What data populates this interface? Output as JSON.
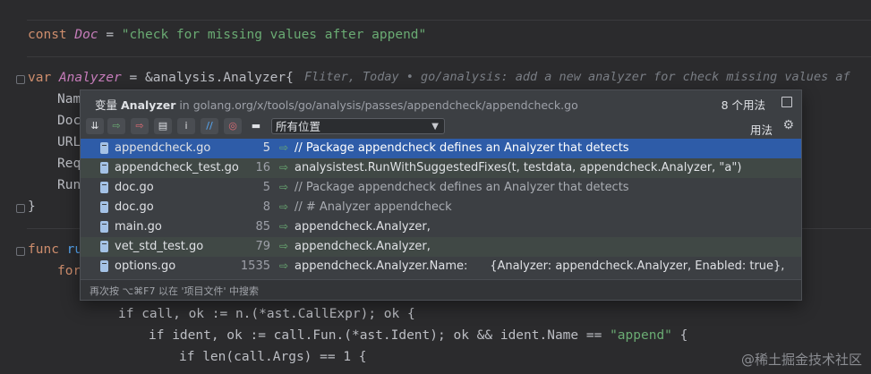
{
  "code": {
    "line_const_kw": "const",
    "line_const_name": "Doc",
    "line_const_eq": " = ",
    "line_const_str": "\"check for missing values after append\"",
    "line_var_kw": "var",
    "line_var_name": " Analyzer",
    "line_var_rest": " = &analysis.Analyzer{",
    "inline_hint": "Fliter, Today • go/analysis: add a new analyzer for check missing values af",
    "field_1": "Nam",
    "field_2": "Doc",
    "field_3": "URL",
    "field_4": "Req",
    "field_5": "Run",
    "close_brace": "}",
    "func_kw": "func",
    "func_rest": " ru",
    "for_kw": "for",
    "if_call_line": "if call, ok := n.(*ast.CallExpr); ok {",
    "if_ident_line_a": "if ident, ok := call.Fun.(*ast.Ident); ok && ident.Name == ",
    "if_ident_str": "\"append\"",
    "if_ident_tail": " {",
    "if_len_line": "if len(call.Args) == 1 {"
  },
  "popup": {
    "title_kind": "变量",
    "title_name": "Analyzer",
    "title_in": " in golang.org/x/tools/go/analysis/passes/appendcheck/appendcheck.go",
    "count": "8 个用法",
    "scope": "所有位置",
    "usage_label": "用法",
    "footer": "再次按 ⌥⌘F7 以在 '项目文件' 中搜索",
    "rows": [
      {
        "file": "appendcheck.go",
        "line": "5",
        "snippet": "// Package appendcheck defines an Analyzer that detects"
      },
      {
        "file": "appendcheck_test.go",
        "line": "16",
        "snippet": "analysistest.RunWithSuggestedFixes(t, testdata, appendcheck.Analyzer, \"a\")"
      },
      {
        "file": "doc.go",
        "line": "5",
        "snippet": "// Package appendcheck defines an Analyzer that detects"
      },
      {
        "file": "doc.go",
        "line": "8",
        "snippet": "// # Analyzer appendcheck"
      },
      {
        "file": "main.go",
        "line": "85",
        "snippet": "appendcheck.Analyzer,"
      },
      {
        "file": "vet_std_test.go",
        "line": "79",
        "snippet": "appendcheck.Analyzer,"
      },
      {
        "file": "options.go",
        "line": "1535",
        "snippet": "appendcheck.Analyzer.Name:      {Analyzer: appendcheck.Analyzer, Enabled: true},"
      }
    ]
  },
  "watermark": "@稀土掘金技术社区",
  "colors": {
    "selection": "#2e5ca8",
    "editor_bg": "#2b2b2d",
    "popup_bg": "#3c3f43"
  }
}
